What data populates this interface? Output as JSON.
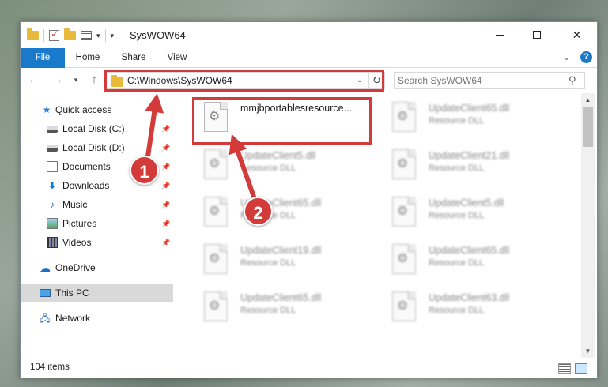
{
  "window": {
    "title": "SysWOW64",
    "minimize_icon": "minimize-icon",
    "maximize_icon": "maximize-icon",
    "close_icon": "close-icon"
  },
  "ribbon": {
    "tabs": [
      {
        "label": "File"
      },
      {
        "label": "Home"
      },
      {
        "label": "Share"
      },
      {
        "label": "View"
      }
    ],
    "help_label": "?"
  },
  "nav": {
    "address": "C:\\Windows\\SysWOW64",
    "search_placeholder": "Search SysWOW64"
  },
  "sidebar": {
    "items": [
      {
        "label": "Quick access",
        "icon": "star-icon"
      },
      {
        "label": "Local Disk (C:)",
        "icon": "disk-icon"
      },
      {
        "label": "Local Disk (D:)",
        "icon": "disk-icon"
      },
      {
        "label": "Documents",
        "icon": "documents-icon"
      },
      {
        "label": "Downloads",
        "icon": "downloads-icon"
      },
      {
        "label": "Music",
        "icon": "music-icon"
      },
      {
        "label": "Pictures",
        "icon": "pictures-icon"
      },
      {
        "label": "Videos",
        "icon": "videos-icon"
      },
      {
        "label": "OneDrive",
        "icon": "cloud-icon"
      },
      {
        "label": "This PC",
        "icon": "computer-icon"
      },
      {
        "label": "Network",
        "icon": "network-icon"
      }
    ]
  },
  "files": [
    {
      "name": "mmjbportablesresource...",
      "type": ""
    },
    {
      "name": "UpdateClient65.dll",
      "type": "Resource DLL"
    },
    {
      "name": "UpdateClient5.dll",
      "type": "Resource DLL"
    },
    {
      "name": "UpdateClient21.dll",
      "type": "Resource DLL"
    },
    {
      "name": "UpdateClient65.dll",
      "type": "Resource DLL"
    },
    {
      "name": "UpdateClient5.dll",
      "type": "Resource DLL"
    },
    {
      "name": "UpdateClient19.dll",
      "type": "Resource DLL"
    },
    {
      "name": "UpdateClient65.dll",
      "type": "Resource DLL"
    },
    {
      "name": "UpdateClient65.dll",
      "type": "Resource DLL"
    },
    {
      "name": "UpdateClient63.dll",
      "type": "Resource DLL"
    }
  ],
  "status": {
    "item_count": "104 items"
  },
  "callouts": {
    "one": "1",
    "two": "2"
  },
  "colors": {
    "accent": "#1979ca",
    "highlight": "#d33a3a",
    "selection": "#cce8ff"
  }
}
